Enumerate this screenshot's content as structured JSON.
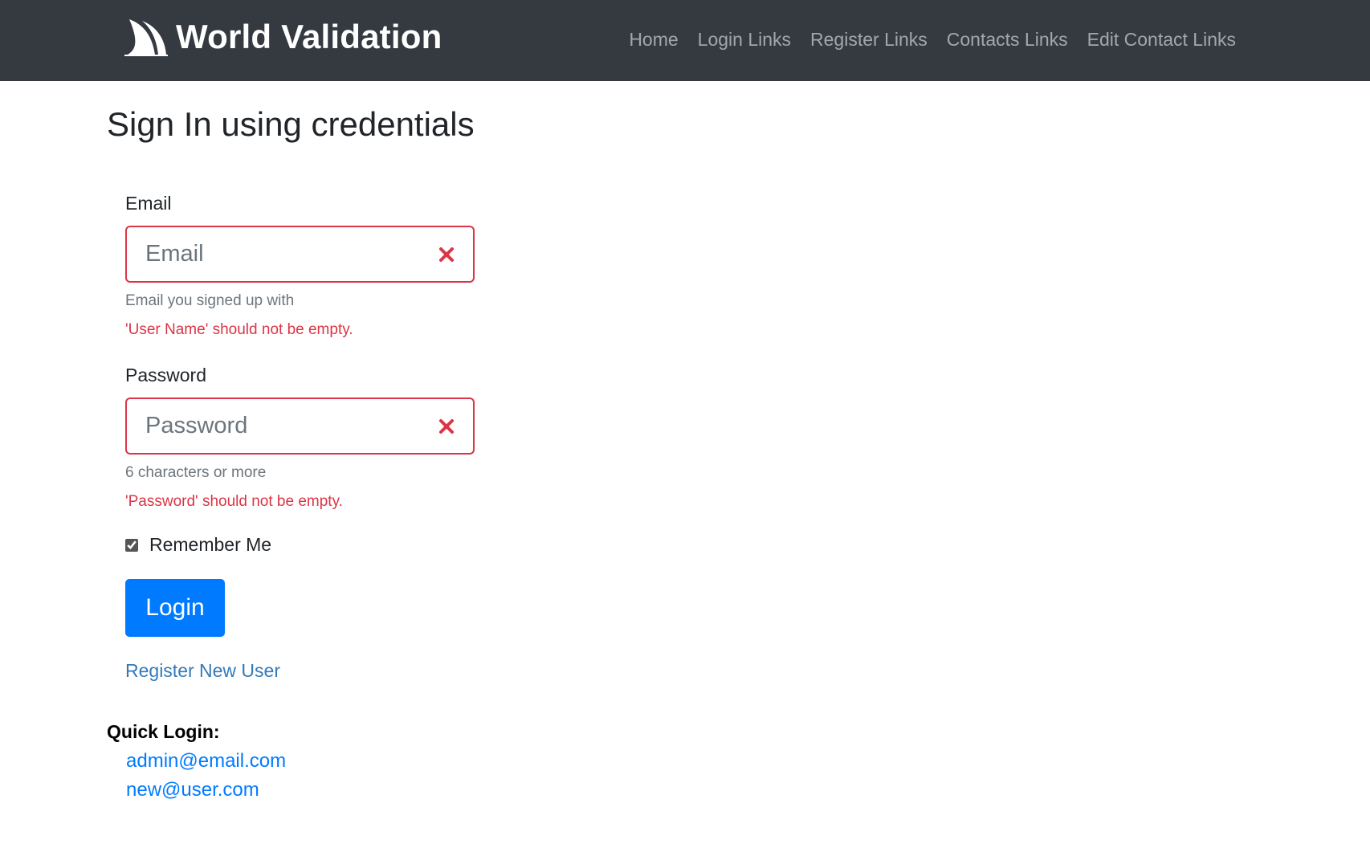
{
  "navbar": {
    "brand": "World Validation",
    "links": [
      "Home",
      "Login Links",
      "Register Links",
      "Contacts Links",
      "Edit Contact Links"
    ]
  },
  "page": {
    "title": "Sign In using credentials"
  },
  "form": {
    "email": {
      "label": "Email",
      "placeholder": "Email",
      "value": "",
      "help": "Email you signed up with",
      "error": "'User Name' should not be empty."
    },
    "password": {
      "label": "Password",
      "placeholder": "Password",
      "value": "",
      "help": "6 characters or more",
      "error": "'Password' should not be empty."
    },
    "remember": {
      "label": "Remember Me",
      "checked": true
    },
    "login_button": "Login",
    "register_link": "Register New User"
  },
  "quick_login": {
    "title": "Quick Login:",
    "accounts": [
      "admin@email.com",
      "new@user.com"
    ]
  },
  "colors": {
    "navbar_bg": "#343a40",
    "error": "#dc3545",
    "primary": "#007bff",
    "link": "#337ab7"
  },
  "icons": {
    "brand": "sail-logo-icon",
    "invalid": "x-mark-icon"
  }
}
